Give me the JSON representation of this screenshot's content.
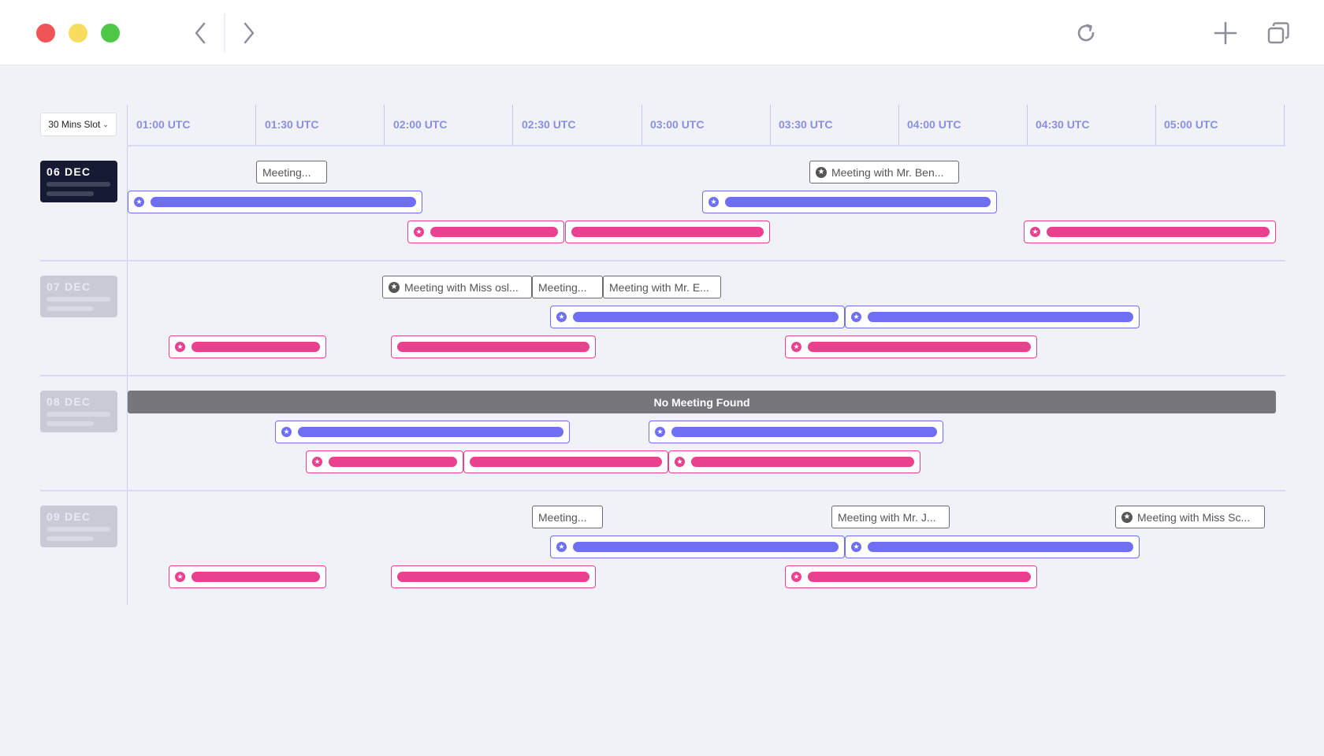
{
  "window": {
    "controls": [
      "close",
      "minimize",
      "maximize"
    ],
    "toolbar_icons": [
      "chevron-left-icon",
      "chevron-right-icon",
      "refresh-icon",
      "plus-icon",
      "copy-icon"
    ]
  },
  "calendar": {
    "slot_select": "30 Mins Slot",
    "times": [
      "01:00 UTC",
      "01:30 UTC",
      "02:00 UTC",
      "02:30 UTC",
      "03:00 UTC",
      "03:30 UTC",
      "04:00 UTC",
      "04:30 UTC",
      "05:00 UTC"
    ],
    "days": [
      {
        "label": "06 DEC",
        "active": true,
        "meetings": [
          "Meeting...",
          "Meeting with Mr. Ben..."
        ]
      },
      {
        "label": "07 DEC",
        "active": false,
        "meetings": [
          "Meeting with Miss osl...",
          "Meeting...",
          "Meeting with Mr. E..."
        ]
      },
      {
        "label": "08 DEC",
        "active": false,
        "meetings": [],
        "banner": "No Meeting Found"
      },
      {
        "label": "09 DEC",
        "active": false,
        "meetings": [
          "Meeting...",
          "Meeting with Mr. J...",
          "Meeting with Miss Sc..."
        ]
      }
    ]
  },
  "colors": {
    "blue": "#6e6ff2",
    "pink": "#e8428f",
    "dark": "#161a33"
  }
}
